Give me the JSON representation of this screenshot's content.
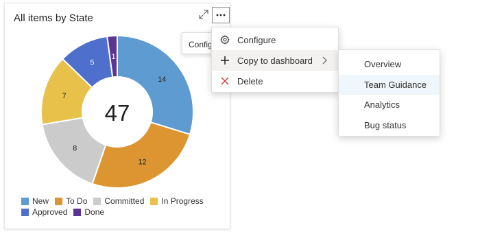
{
  "widget": {
    "title": "All items by State",
    "total": "47",
    "expand_icon": "expand-icon",
    "more_icon": "more-options-icon"
  },
  "tooltip": {
    "text": "Configure"
  },
  "menu": {
    "items": [
      {
        "label": "Configure",
        "icon": "gear-icon"
      },
      {
        "label": "Copy to dashboard",
        "icon": "plus-icon",
        "submenu": true
      },
      {
        "label": "Delete",
        "icon": "close-icon"
      }
    ]
  },
  "submenu": {
    "items": [
      {
        "label": "Overview"
      },
      {
        "label": "Team Guidance",
        "highlighted": true
      },
      {
        "label": "Analytics"
      },
      {
        "label": "Bug status"
      }
    ]
  },
  "chart_data": {
    "type": "pie",
    "categories": [
      "New",
      "To Do",
      "Committed",
      "In Progress",
      "Approved",
      "Done"
    ],
    "values": [
      14,
      12,
      8,
      7,
      5,
      1
    ],
    "colors": [
      "#5e9bd0",
      "#dc9530",
      "#cbcbcb",
      "#e8c14a",
      "#4e6fcc",
      "#5c3494"
    ],
    "total": 47,
    "legend": "bottom"
  }
}
